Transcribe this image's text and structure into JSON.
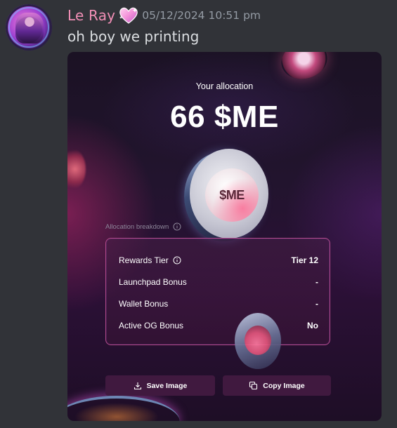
{
  "message": {
    "username": "Le Ray",
    "username_color": "#f28fb6",
    "timestamp": "05/12/2024 10:51 pm",
    "text": "oh boy we printing",
    "badge_icon": "sparkling-heart-icon"
  },
  "card": {
    "allocation_label": "Your allocation",
    "allocation_amount": "66 $ME",
    "coin_label": "$ME",
    "breakdown_label": "Allocation breakdown",
    "rows": [
      {
        "label": "Rewards Tier",
        "value": "Tier 12",
        "has_info": true
      },
      {
        "label": "Launchpad Bonus",
        "value": "-"
      },
      {
        "label": "Wallet Bonus",
        "value": "-"
      },
      {
        "label": "Active OG Bonus",
        "value": "No"
      }
    ],
    "buttons": {
      "save": "Save Image",
      "copy": "Copy Image"
    },
    "accent_border": "#b54b8b",
    "button_color": "#40193f"
  }
}
